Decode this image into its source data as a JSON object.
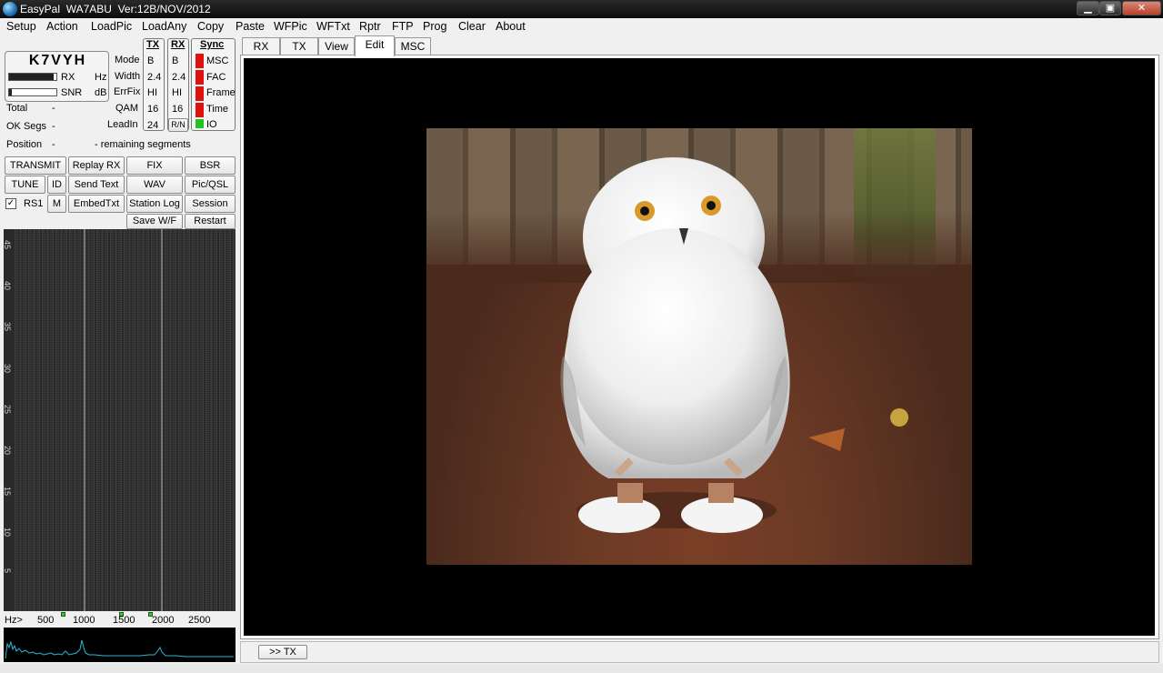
{
  "window": {
    "title": "EasyPal  WA7ABU  Ver:12B/NOV/2012",
    "minimize": "▁",
    "maximize": "▣",
    "close": "✕"
  },
  "menu": [
    "Setup",
    "Action",
    "LoadPic",
    "LoadAny",
    "Copy",
    "Paste",
    "WFPic",
    "WFTxt",
    "Rptr",
    "FTP",
    "Prog",
    "Clear",
    "About"
  ],
  "status": {
    "callsign": "K7VYH",
    "rx_label": "RX",
    "hz_label": "Hz",
    "snr_label": "SNR",
    "db_label": "dB",
    "rx_level": 0.95,
    "snr_level": 0.05,
    "total_label": "Total",
    "total_value": "-",
    "ok_segs_label": "OK Segs",
    "ok_segs_value": "-",
    "position_label": "Position",
    "position_value": "-",
    "remaining_label": "-  remaining segments"
  },
  "params": {
    "labels": [
      "Mode",
      "Width",
      "ErrFix",
      "QAM",
      "LeadIn"
    ],
    "tx_header": "TX",
    "rx_header": "RX",
    "tx_values": [
      "B",
      "2.4",
      "HI",
      "16",
      "24"
    ],
    "rx_values": [
      "B",
      "2.4",
      "HI",
      "16"
    ],
    "rn_label": "R/N"
  },
  "sync": {
    "header": "Sync",
    "items": [
      {
        "label": "MSC",
        "color": "#e01010"
      },
      {
        "label": "FAC",
        "color": "#e01010"
      },
      {
        "label": "Frame",
        "color": "#e01010"
      },
      {
        "label": "Time",
        "color": "#e01010"
      },
      {
        "label": "IO",
        "color": "#22c422"
      }
    ]
  },
  "buttons": {
    "transmit": "TRANSMIT",
    "replay_rx": "Replay RX",
    "fix": "FIX",
    "bsr": "BSR",
    "tune": "TUNE",
    "id": "ID",
    "send_text": "Send Text",
    "wav": "WAV",
    "pic_qsl": "Pic/QSL",
    "rs1_label": "RS1",
    "rs1_check": "✓",
    "m": "M",
    "embed_txt": "EmbedTxt",
    "station_log": "Station Log",
    "session": "Session",
    "save_wf": "Save W/F",
    "restart": "Restart"
  },
  "waterfall": {
    "scale": [
      "45",
      "40",
      "35",
      "30",
      "25",
      "20",
      "15",
      "10",
      "5"
    ],
    "hz_prefix": "Hz>",
    "hz_ticks": [
      "500",
      "1000",
      "1500",
      "2000",
      "2500"
    ]
  },
  "tabs": [
    "RX",
    "TX",
    "View",
    "Edit",
    "MSC"
  ],
  "active_tab": "Edit",
  "bottom": {
    "to_tx_button": ">> TX"
  },
  "colors": {
    "led_red": "#e01010",
    "led_green": "#22c422",
    "spectrum": "#29b9d6"
  }
}
